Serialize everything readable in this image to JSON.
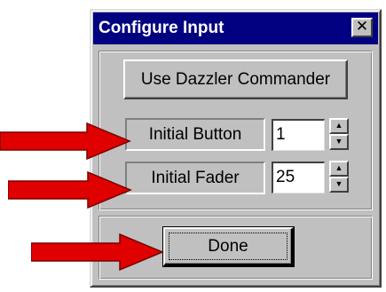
{
  "window": {
    "title": "Configure Input",
    "close_glyph": "✕"
  },
  "buttons": {
    "dazzler": "Use Dazzler Commander",
    "done": "Done"
  },
  "fields": [
    {
      "label": "Initial Button",
      "value": "1"
    },
    {
      "label": "Initial Fader",
      "value": "25"
    }
  ],
  "spinner": {
    "up_glyph": "▲",
    "down_glyph": "▼"
  },
  "icons": {
    "close": "close-icon",
    "annotation_arrow": "red-arrow-icon"
  },
  "colors": {
    "titlebar": "#000080",
    "face": "#c0c0c0",
    "arrow": "#e00000"
  }
}
